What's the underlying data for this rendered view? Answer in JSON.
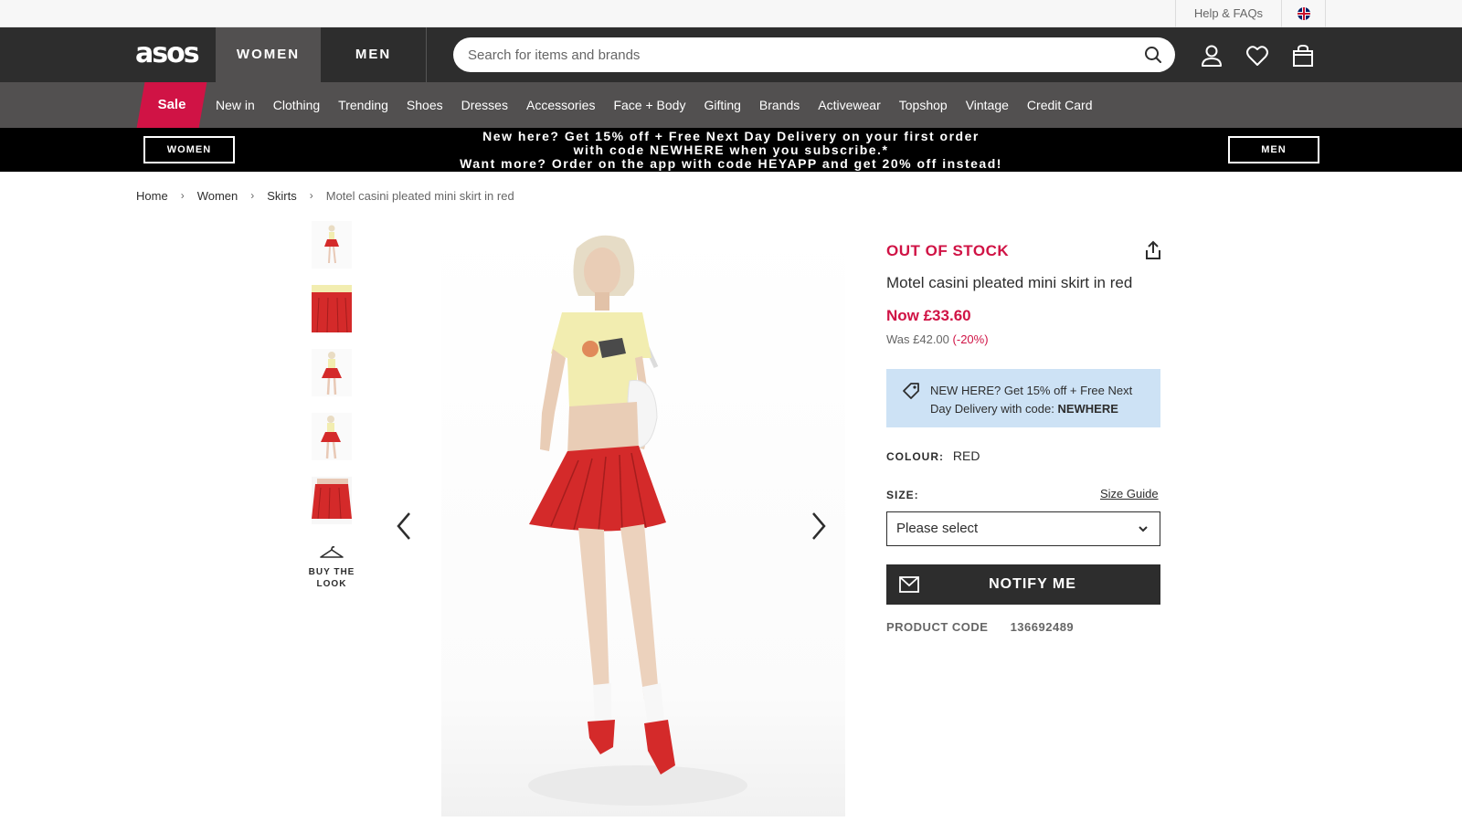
{
  "utility": {
    "help_label": "Help & FAQs",
    "flag_icon": "uk-flag-icon"
  },
  "header": {
    "logo": "asos",
    "tab_women": "WOMEN",
    "tab_men": "MEN",
    "search_placeholder": "Search for items and brands",
    "icons": [
      "search-icon",
      "account-icon",
      "heart-icon",
      "bag-icon"
    ]
  },
  "nav": {
    "sale": "Sale",
    "items": [
      "New in",
      "Clothing",
      "Trending",
      "Shoes",
      "Dresses",
      "Accessories",
      "Face + Body",
      "Gifting",
      "Brands",
      "Activewear",
      "Topshop",
      "Vintage",
      "Credit Card"
    ]
  },
  "promo": {
    "women_btn": "WOMEN",
    "men_btn": "MEN",
    "line1": "New here? Get 15% off + Free Next Day Delivery on your first order",
    "line2": "with code NEWHERE when you subscribe.*",
    "line3": "Want more? Order on the app with code HEYAPP and get 20% off instead!"
  },
  "breadcrumb": {
    "items": [
      "Home",
      "Women",
      "Skirts"
    ],
    "current": "Motel casini pleated mini skirt in red",
    "separator": "›"
  },
  "gallery": {
    "buy_the_look": "BUY THE LOOK"
  },
  "product": {
    "stock_status": "OUT OF STOCK",
    "name": "Motel casini pleated mini skirt in red",
    "now_price": "Now £33.60",
    "was_price": "Was £42.00",
    "discount": "(-20%)",
    "promo_text": "NEW HERE? Get 15% off + Free Next Day Delivery with code:",
    "promo_code": "NEWHERE",
    "colour_label": "COLOUR:",
    "colour_value": "RED",
    "size_label": "SIZE:",
    "size_guide": "Size Guide",
    "size_placeholder": "Please select",
    "notify_btn": "NOTIFY ME",
    "code_label": "PRODUCT CODE",
    "code_value": "136692489"
  },
  "colors": {
    "header_bg": "#2d2d2d",
    "nav_bg": "#525050",
    "sale_red": "#d01345",
    "promo_box_blue": "#cde2f5",
    "skirt_red": "#d42a2a",
    "top_yellow": "#f2edb0"
  }
}
